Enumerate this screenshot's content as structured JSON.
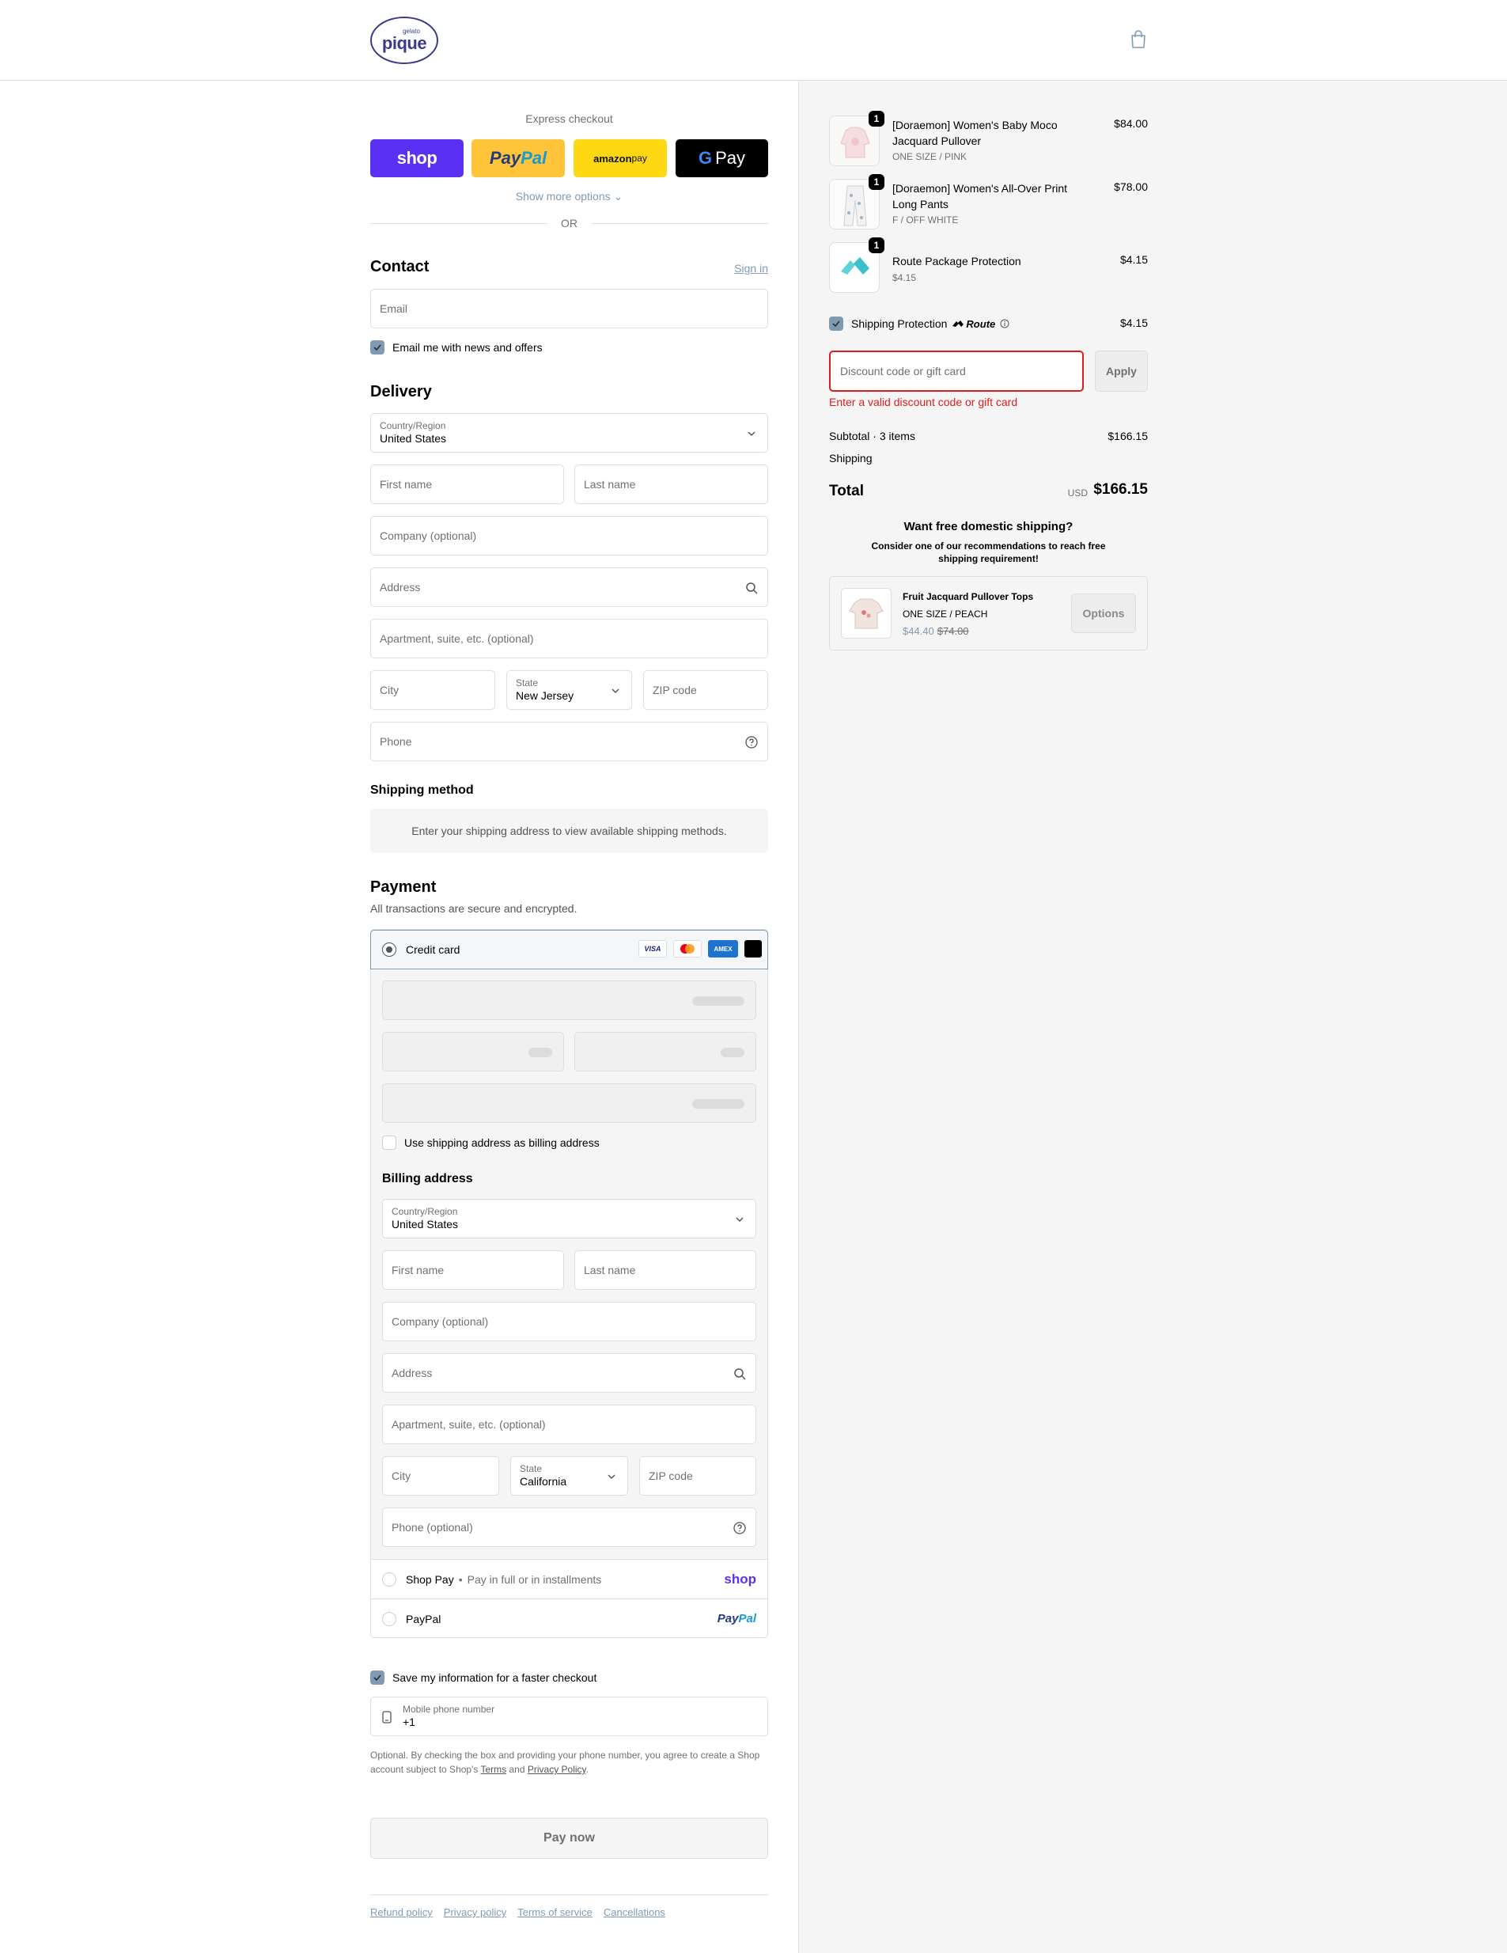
{
  "brand": {
    "logo_small": "gelato",
    "logo_big": "pique"
  },
  "express": {
    "label": "Express checkout",
    "shop_label": "shop",
    "paypal_label_1": "Pay",
    "paypal_label_2": "Pal",
    "amazon_label_1": "amazon",
    "amazon_label_2": " pay",
    "gpay_g": "G",
    "gpay_label": "Pay",
    "show_more": "Show more options",
    "or": "OR"
  },
  "contact": {
    "title": "Contact",
    "sign_in": "Sign in",
    "email_placeholder": "Email",
    "news_label": "Email me with news and offers",
    "news_checked": true
  },
  "delivery": {
    "title": "Delivery",
    "country_label": "Country/Region",
    "country_value": "United States",
    "first_name": "First name",
    "last_name": "Last name",
    "company": "Company (optional)",
    "address": "Address",
    "apartment": "Apartment, suite, etc. (optional)",
    "city": "City",
    "state_label": "State",
    "state_value": "New Jersey",
    "zip": "ZIP code",
    "phone": "Phone"
  },
  "shipping_method": {
    "title": "Shipping method",
    "notice": "Enter your shipping address to view available shipping methods."
  },
  "payment": {
    "title": "Payment",
    "subtitle": "All transactions are secure and encrypted.",
    "credit_card": "Credit card",
    "card_logos": [
      "VISA",
      "mastercard",
      "AMEX",
      "other"
    ],
    "same_billing": "Use shipping address as billing address",
    "billing_title": "Billing address",
    "billing": {
      "country_label": "Country/Region",
      "country_value": "United States",
      "first_name": "First name",
      "last_name": "Last name",
      "company": "Company (optional)",
      "address": "Address",
      "apartment": "Apartment, suite, etc. (optional)",
      "city": "City",
      "state_label": "State",
      "state_value": "California",
      "zip": "ZIP code",
      "phone": "Phone (optional)"
    },
    "shop_pay": "Shop Pay",
    "shop_pay_note": "Pay in full or in installments",
    "shop_pay_logo": "shop",
    "paypal": "PayPal",
    "paypal_logo_1": "Pay",
    "paypal_logo_2": "Pal"
  },
  "save_info": {
    "label": "Save my information for a faster checkout",
    "checked": true,
    "mobile_label": "Mobile phone number",
    "mobile_value": "+1",
    "legal_1": "Optional. By checking the box and providing your phone number, you agree to create a Shop account subject to Shop's ",
    "terms": "Terms",
    "and": " and ",
    "privacy": "Privacy Policy",
    "period": "."
  },
  "pay_now": "Pay now",
  "footer_links": [
    "Refund policy",
    "Privacy policy",
    "Terms of service",
    "Cancellations"
  ],
  "summary": {
    "items": [
      {
        "qty": "1",
        "name": "[Doraemon] Women's Baby Moco Jacquard Pullover",
        "variant": "ONE SIZE / PINK",
        "price": "$84.00"
      },
      {
        "qty": "1",
        "name": "[Doraemon] Women's All-Over Print Long Pants",
        "variant": "F / OFF WHITE",
        "price": "$78.00"
      },
      {
        "qty": "1",
        "name": "Route Package Protection",
        "variant": "$4.15",
        "price": "$4.15"
      }
    ],
    "protection_label": "Shipping Protection",
    "protection_brand": "Route",
    "protection_price": "$4.15",
    "discount_placeholder": "Discount code or gift card",
    "apply": "Apply",
    "discount_error": "Enter a valid discount code or gift card",
    "subtotal_label": "Subtotal · 3 items",
    "subtotal_value": "$166.15",
    "shipping_label": "Shipping",
    "total_label": "Total",
    "currency": "USD",
    "total_value": "$166.15",
    "upsell_title": "Want free domestic shipping?",
    "upsell_sub": "Consider one of our recommendations to reach free shipping requirement!",
    "upsell_item": {
      "name": "Fruit Jacquard Pullover Tops",
      "variant": "ONE SIZE / PEACH",
      "sale_price": "$44.40",
      "orig_price": "$74.00",
      "button": "Options"
    }
  },
  "colors": {
    "accent": "#7f9bb3",
    "error": "#dd1d1d",
    "shop_purple": "#5a31f4",
    "paypal_yellow": "#ffc439",
    "amazon_yellow": "#ffd814"
  }
}
